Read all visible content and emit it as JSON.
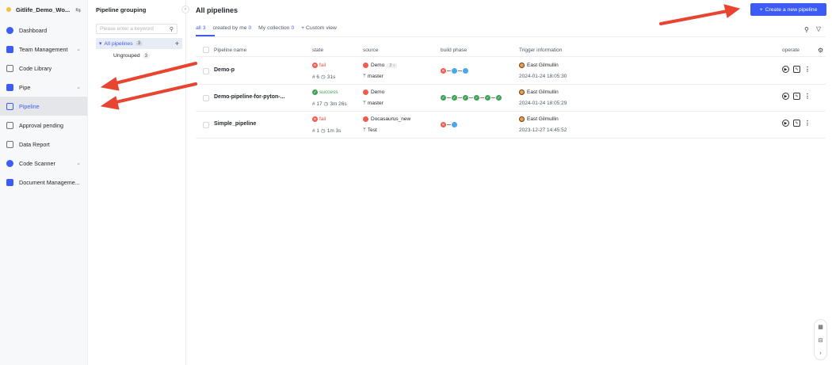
{
  "workspace": {
    "name": "Gitlife_Demo_Wo..."
  },
  "nav": {
    "items": [
      {
        "label": "Dashboard"
      },
      {
        "label": "Team Management"
      },
      {
        "label": "Code Library"
      },
      {
        "label": "Pipe"
      },
      {
        "label": "Pipeline"
      },
      {
        "label": "Approval pending"
      },
      {
        "label": "Data Report"
      },
      {
        "label": "Code Scanner"
      },
      {
        "label": "Document Manageme..."
      }
    ]
  },
  "groups": {
    "title": "Pipeline grouping",
    "search_placeholder": "Please enter a keyword",
    "all_label": "All pipelines",
    "all_count": "3",
    "ungrouped_label": "Ungrouped",
    "ungrouped_count": "3"
  },
  "main": {
    "title": "All pipelines",
    "create_button": "Create a new pipeline",
    "tabs": [
      {
        "label": "all",
        "count": "3"
      },
      {
        "label": "created by me",
        "count": "0"
      },
      {
        "label": "My collection",
        "count": "0"
      },
      {
        "label": "Custom view"
      }
    ],
    "columns": {
      "name": "Pipeline name",
      "state": "state",
      "source": "source",
      "phase": "build phase",
      "trigger": "Trigger information",
      "operate": "operate"
    },
    "rows": [
      {
        "name": "Demo-p",
        "state": "fail",
        "run": "# 6",
        "duration": "31s",
        "repo": "Demo",
        "repo_extra": "2",
        "branch": "master",
        "phases": [
          "red",
          "blue",
          "blue"
        ],
        "user": "East Gilmullin",
        "time": "2024-01-24 18:05:30"
      },
      {
        "name": "Demo-pipeline-for-pyton-...",
        "state": "success",
        "run": "# 17",
        "duration": "3m 26s",
        "repo": "Demo",
        "repo_extra": "",
        "branch": "master",
        "phases": [
          "green",
          "green",
          "green",
          "green",
          "green",
          "green"
        ],
        "user": "East Gilmullin",
        "time": "2024-01-24 18:05:29"
      },
      {
        "name": "Simple_pipeline",
        "state": "fail",
        "run": "# 1",
        "duration": "1m 3s",
        "repo": "Docasaurus_new",
        "repo_extra": "",
        "branch": "Test",
        "phases": [
          "red",
          "blue"
        ],
        "user": "East Gilmullin",
        "time": "2023-12-27 14:45:52"
      }
    ]
  },
  "colors": {
    "accent": "#3d5cf5",
    "fail": "#e8553e",
    "success": "#3da357",
    "annotation_arrow": "#e8442f"
  }
}
